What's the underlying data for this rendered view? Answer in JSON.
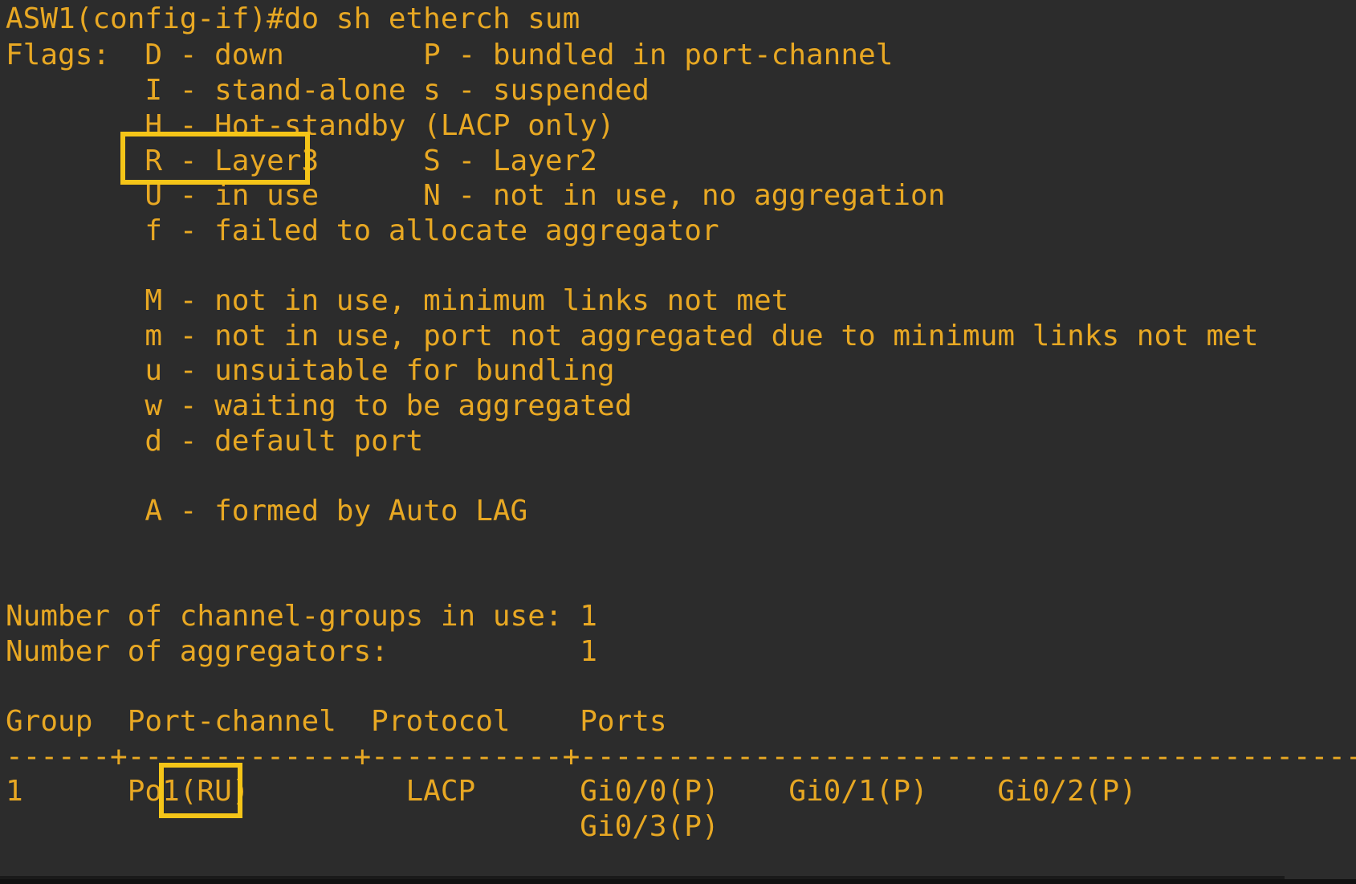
{
  "terminal": {
    "prompt_line": "ASW1(config-if)#do sh etherch sum",
    "flags_lines": [
      "Flags:  D - down        P - bundled in port-channel",
      "        I - stand-alone s - suspended",
      "        H - Hot-standby (LACP only)",
      "        R - Layer3      S - Layer2",
      "        U - in use      N - not in use, no aggregation",
      "        f - failed to allocate aggregator",
      "",
      "        M - not in use, minimum links not met",
      "        m - not in use, port not aggregated due to minimum links not met",
      "        u - unsuitable for bundling",
      "        w - waiting to be aggregated",
      "        d - default port",
      "",
      "        A - formed by Auto LAG"
    ],
    "summary_lines": [
      "Number of channel-groups in use: 1",
      "Number of aggregators:           1"
    ],
    "table_header": "Group  Port-channel  Protocol    Ports",
    "table_separator": "------+-------------+-----------+-----------------------------------------------",
    "table_row": "1      Po1(RU)         LACP      Gi0/0(P)    Gi0/1(P)    Gi0/2(P)",
    "table_row_cut": "                                 Gi0/3(P)"
  },
  "colors": {
    "background": "#2c2c2c",
    "text": "#e8a823",
    "highlight": "#f5c518"
  }
}
